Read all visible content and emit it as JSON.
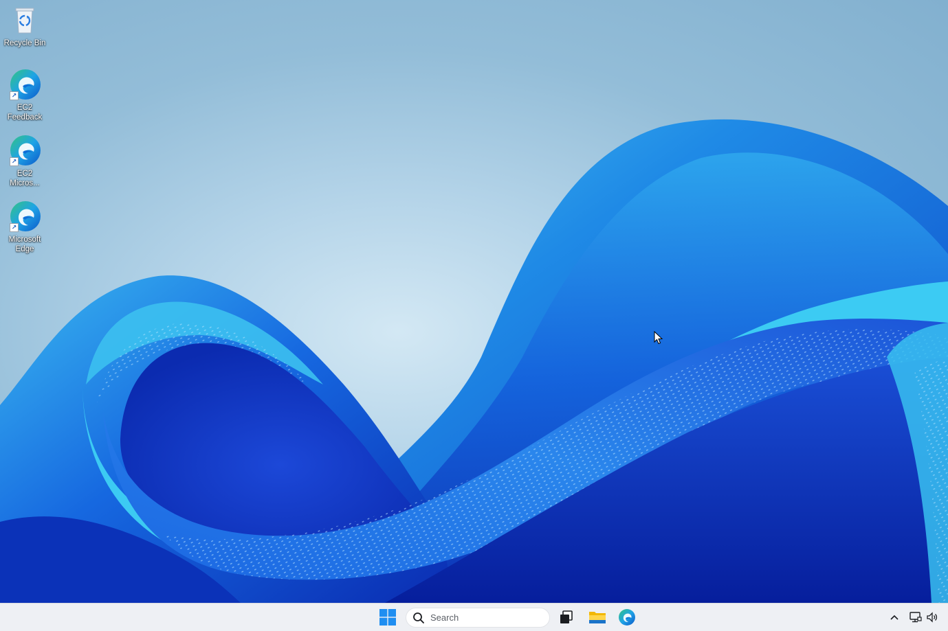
{
  "desktop": {
    "icons": [
      {
        "label": "Recycle Bin",
        "icon": "recycle-bin-icon"
      },
      {
        "label": "EC2 Feedback",
        "icon": "edge-icon",
        "shortcut": true
      },
      {
        "label": "EC2 Micros...",
        "icon": "edge-icon",
        "shortcut": true
      },
      {
        "label": "Microsoft Edge",
        "icon": "edge-icon",
        "shortcut": true
      }
    ]
  },
  "taskbar": {
    "start_icon": "windows-start-icon",
    "search": {
      "placeholder": "Search",
      "icon": "search-icon"
    },
    "pinned": [
      {
        "icon": "task-view-icon"
      },
      {
        "icon": "file-explorer-icon"
      },
      {
        "icon": "edge-icon"
      }
    ],
    "tray": [
      {
        "icon": "chevron-up-icon"
      },
      {
        "icon": "network-icon"
      },
      {
        "icon": "volume-icon"
      }
    ]
  },
  "colors": {
    "taskbar_bg": "#eef0f4",
    "start_blue": "#1f8ef1",
    "wallpaper_deep": "#0a2bb5",
    "wallpaper_mid": "#1a6ee6",
    "wallpaper_light": "#3ec4f2"
  }
}
